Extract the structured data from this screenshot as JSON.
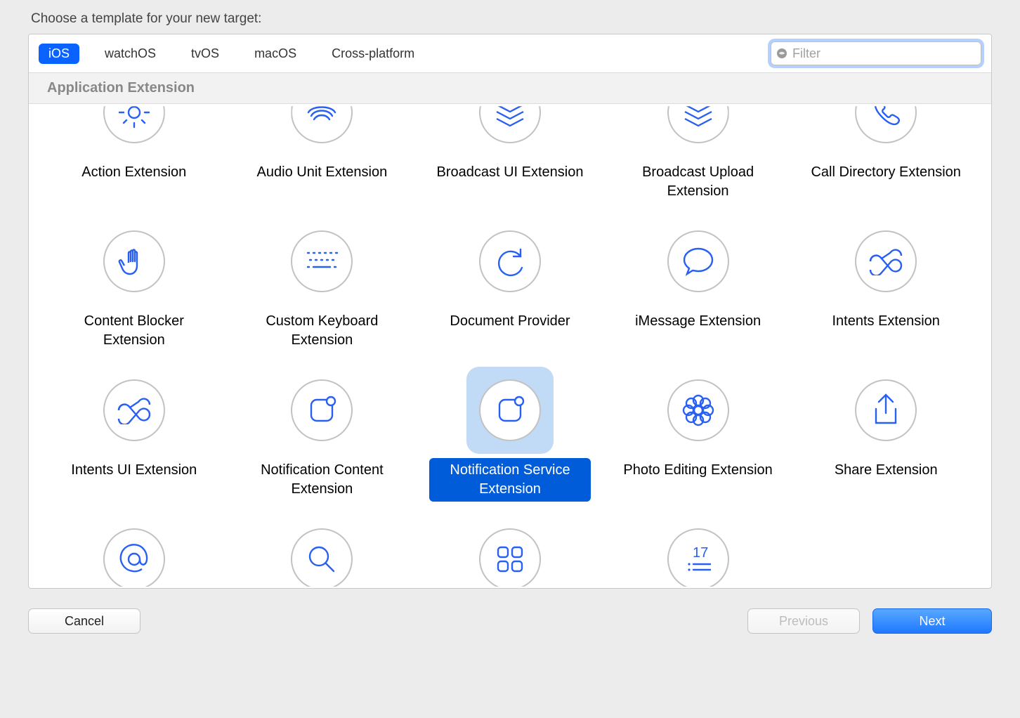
{
  "dialog": {
    "title": "Choose a template for your new target:",
    "tabs": [
      "iOS",
      "watchOS",
      "tvOS",
      "macOS",
      "Cross-platform"
    ],
    "active_tab": "iOS",
    "filter_placeholder": "Filter",
    "section_header": "Application Extension",
    "selected_template": "Notification Service Extension",
    "templates": {
      "r0": [
        "Action Extension",
        "Audio Unit Extension",
        "Broadcast UI Extension",
        "Broadcast Upload Extension",
        "Call Directory Extension"
      ],
      "r1": [
        "Content Blocker Extension",
        "Custom Keyboard Extension",
        "Document Provider",
        "iMessage Extension",
        "Intents Extension"
      ],
      "r2": [
        "Intents UI Extension",
        "Notification Content Extension",
        "Notification Service Extension",
        "Photo Editing Extension",
        "Share Extension"
      ],
      "r3": [
        "",
        "",
        "",
        "",
        ""
      ]
    }
  },
  "footer": {
    "cancel": "Cancel",
    "previous": "Previous",
    "next": "Next"
  }
}
